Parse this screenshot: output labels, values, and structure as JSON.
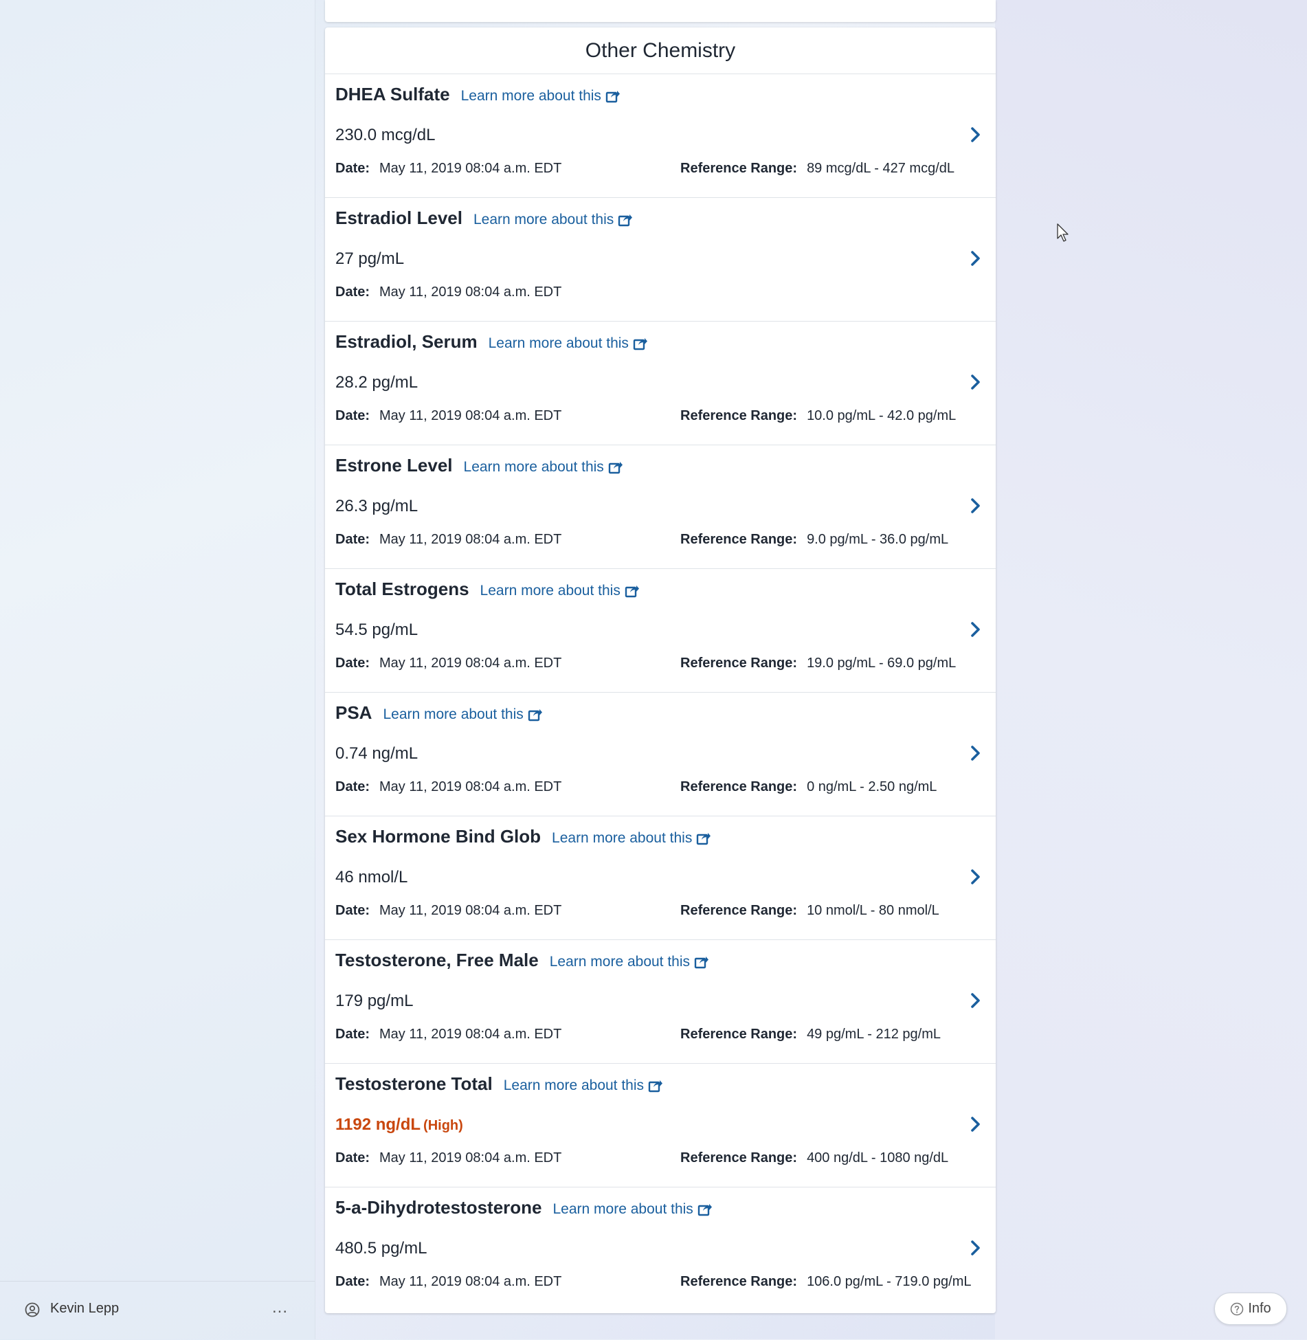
{
  "section": {
    "title": "Other Chemistry"
  },
  "link_label": "Learn more about this",
  "labels": {
    "date": "Date:",
    "reference": "Reference Range:"
  },
  "items": [
    {
      "name": "DHEA Sulfate",
      "value": "230.0 mcg/dL",
      "date": "May 11, 2019 08:04 a.m. EDT",
      "reference": "89 mcg/dL - 427 mcg/dL"
    },
    {
      "name": "Estradiol Level",
      "value": "27 pg/mL",
      "date": "May 11, 2019 08:04 a.m. EDT"
    },
    {
      "name": "Estradiol, Serum",
      "value": "28.2 pg/mL",
      "date": "May 11, 2019 08:04 a.m. EDT",
      "reference": "10.0 pg/mL - 42.0 pg/mL"
    },
    {
      "name": "Estrone Level",
      "value": "26.3 pg/mL",
      "date": "May 11, 2019 08:04 a.m. EDT",
      "reference": "9.0 pg/mL - 36.0 pg/mL"
    },
    {
      "name": "Total Estrogens",
      "value": "54.5 pg/mL",
      "date": "May 11, 2019 08:04 a.m. EDT",
      "reference": "19.0 pg/mL - 69.0 pg/mL"
    },
    {
      "name": "PSA",
      "value": "0.74 ng/mL",
      "date": "May 11, 2019 08:04 a.m. EDT",
      "reference": "0 ng/mL - 2.50 ng/mL"
    },
    {
      "name": "Sex Hormone Bind Glob",
      "value": "46 nmol/L",
      "date": "May 11, 2019 08:04 a.m. EDT",
      "reference": "10 nmol/L - 80 nmol/L"
    },
    {
      "name": "Testosterone, Free Male",
      "value": "179 pg/mL",
      "date": "May 11, 2019 08:04 a.m. EDT",
      "reference": "49 pg/mL - 212 pg/mL"
    },
    {
      "name": "Testosterone Total",
      "value": "1192 ng/dL",
      "flag": "(High)",
      "date": "May 11, 2019 08:04 a.m. EDT",
      "reference": "400 ng/dL - 1080 ng/dL"
    },
    {
      "name": "5-a-Dihydrotestosterone",
      "value": "480.5 pg/mL",
      "date": "May 11, 2019 08:04 a.m. EDT",
      "reference": "106.0 pg/mL - 719.0 pg/mL"
    }
  ],
  "user": {
    "name": "Kevin Lepp",
    "more": "..."
  },
  "info_button": {
    "label": "Info"
  },
  "icons": {
    "external": "external-link-icon",
    "chevron": "chevron-right-icon",
    "user": "user-circle-icon",
    "info": "question-circle-icon"
  },
  "colors": {
    "link": "#1a5f9e",
    "high": "#c9470e",
    "text": "#1f2733"
  }
}
